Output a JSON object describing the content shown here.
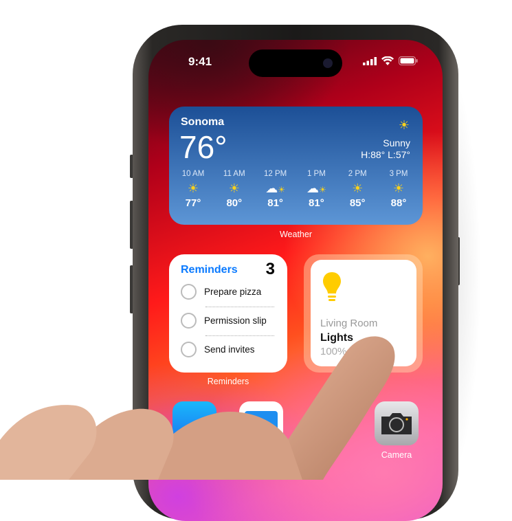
{
  "status_bar": {
    "time": "9:41"
  },
  "weather": {
    "city": "Sonoma",
    "temperature": "76°",
    "condition": "Sunny",
    "high_low": "H:88° L:57°",
    "condition_icon": "sun-icon",
    "hourly": [
      {
        "time": "10 AM",
        "icon": "sun",
        "temp": "77°"
      },
      {
        "time": "11 AM",
        "icon": "sun",
        "temp": "80°"
      },
      {
        "time": "12 PM",
        "icon": "partly-cloudy",
        "temp": "81°"
      },
      {
        "time": "1 PM",
        "icon": "partly-cloudy",
        "temp": "81°"
      },
      {
        "time": "2 PM",
        "icon": "sun",
        "temp": "85°"
      },
      {
        "time": "3 PM",
        "icon": "sun",
        "temp": "88°"
      }
    ],
    "label": "Weather"
  },
  "reminders": {
    "title": "Reminders",
    "count": "3",
    "items": [
      "Prepare pizza",
      "Permission slip",
      "Send invites"
    ],
    "label": "Reminders",
    "accent": "#0a7aff"
  },
  "home": {
    "room": "Living Room",
    "accessory": "Lights",
    "level": "100%",
    "bulb_color": "#ffcc00"
  },
  "dock_apps": [
    {
      "name": "App Store"
    },
    {
      "name": "Files"
    },
    {
      "name": "Camera",
      "label": "Camera"
    }
  ]
}
